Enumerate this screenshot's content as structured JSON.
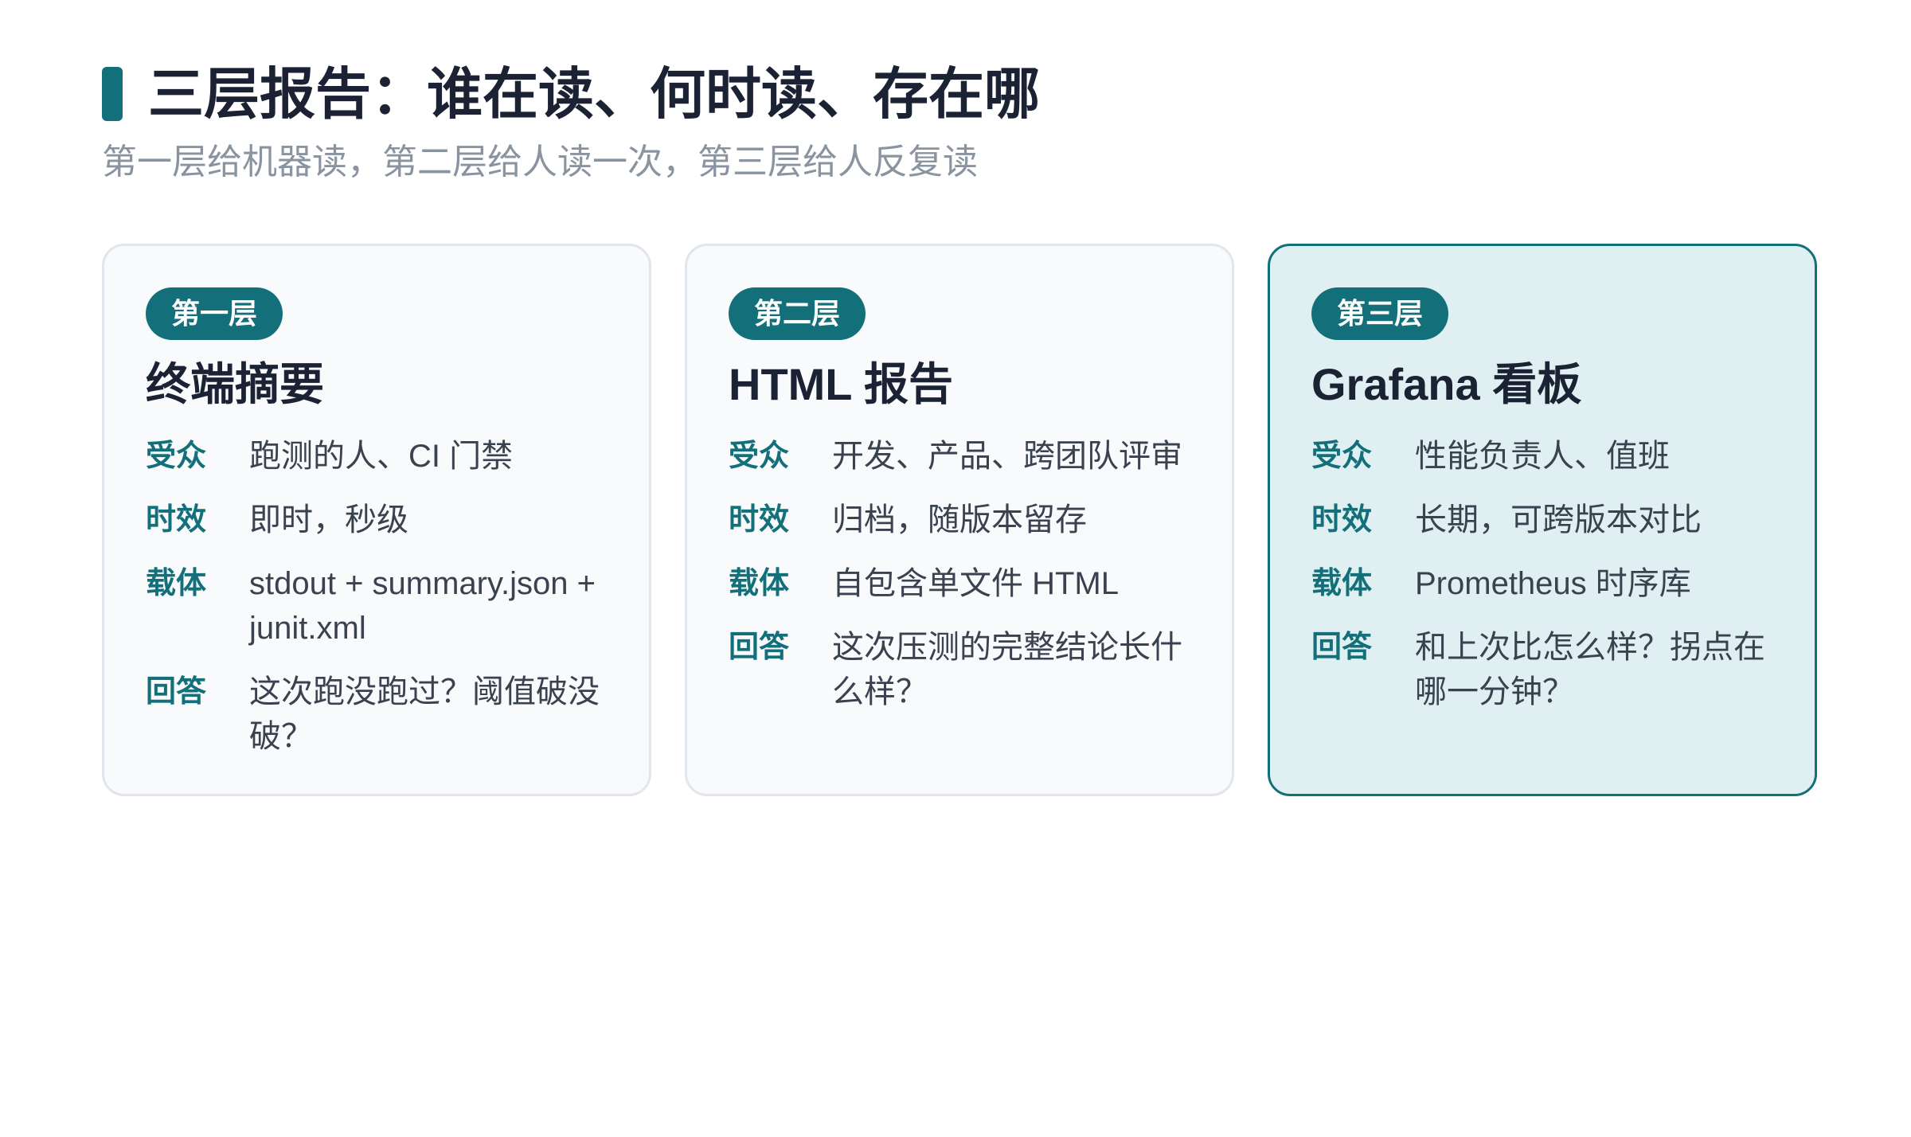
{
  "colors": {
    "accent": "#13707a",
    "title": "#1a2233",
    "subtitle": "#8a94a0",
    "card_bg": "#f8fafc",
    "card_border": "#e1e6ec",
    "highlight_bg": "#e0f0f2",
    "highlight_border": "#13707a"
  },
  "header": {
    "title": "三层报告：谁在读、何时读、存在哪",
    "subtitle": "第一层给机器读，第二层给人读一次，第三层给人反复读"
  },
  "cards": [
    {
      "badge": "第一层",
      "title": "终端摘要",
      "highlighted": false,
      "rows": [
        {
          "label": "受众",
          "value": "跑测的人、CI 门禁"
        },
        {
          "label": "时效",
          "value": "即时，秒级"
        },
        {
          "label": "载体",
          "value": "stdout + summary.json + junit.xml"
        },
        {
          "label": "回答",
          "value": "这次跑没跑过？阈值破没破？"
        }
      ]
    },
    {
      "badge": "第二层",
      "title": "HTML 报告",
      "highlighted": false,
      "rows": [
        {
          "label": "受众",
          "value": "开发、产品、跨团队评审"
        },
        {
          "label": "时效",
          "value": "归档，随版本留存"
        },
        {
          "label": "载体",
          "value": "自包含单文件 HTML"
        },
        {
          "label": "回答",
          "value": "这次压测的完整结论长什么样？"
        }
      ]
    },
    {
      "badge": "第三层",
      "title": "Grafana 看板",
      "highlighted": true,
      "rows": [
        {
          "label": "受众",
          "value": "性能负责人、值班"
        },
        {
          "label": "时效",
          "value": "长期，可跨版本对比"
        },
        {
          "label": "载体",
          "value": "Prometheus 时序库"
        },
        {
          "label": "回答",
          "value": "和上次比怎么样？拐点在哪一分钟？"
        }
      ]
    }
  ]
}
